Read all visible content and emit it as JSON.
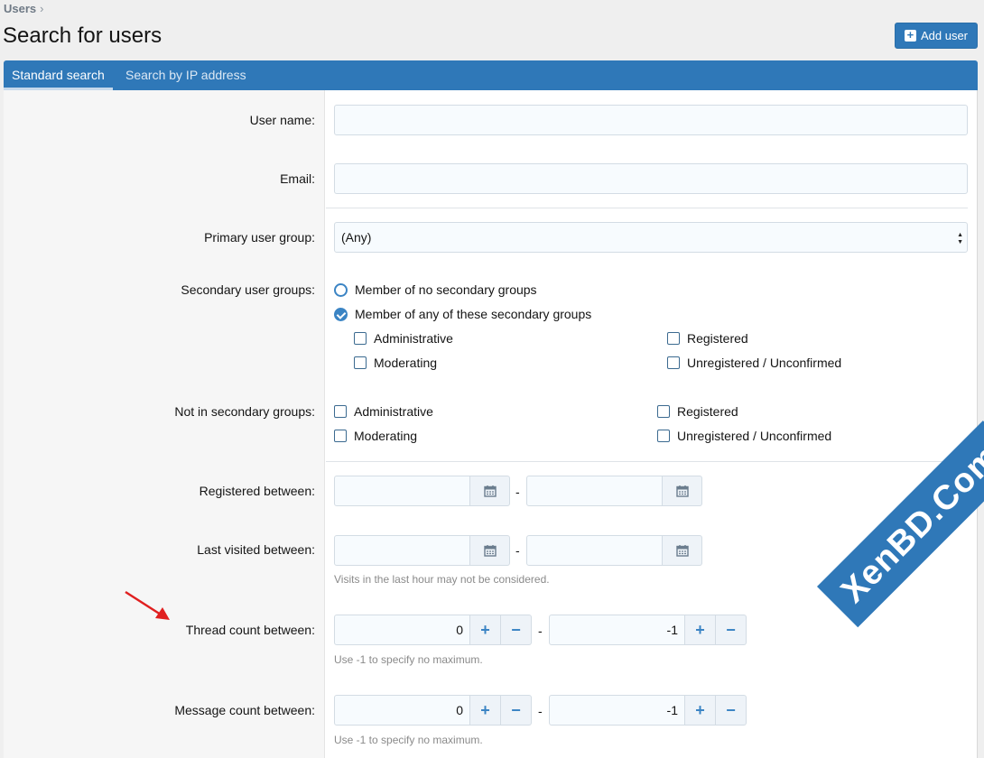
{
  "breadcrumb": {
    "item": "Users",
    "separator": "›"
  },
  "page_title": "Search for users",
  "add_user_label": "Add user",
  "tabs": [
    {
      "label": "Standard search",
      "active": true
    },
    {
      "label": "Search by IP address",
      "active": false
    }
  ],
  "form": {
    "user_name_label": "User name:",
    "user_name_value": "",
    "email_label": "Email:",
    "email_value": "",
    "primary_group_label": "Primary user group:",
    "primary_group_value": "(Any)",
    "secondary_groups_label": "Secondary user groups:",
    "secondary_options": [
      {
        "label": "Member of no secondary groups",
        "checked": false
      },
      {
        "label": "Member of any of these secondary groups",
        "checked": true
      }
    ],
    "secondary_groups": [
      "Administrative",
      "Registered",
      "Moderating",
      "Unregistered / Unconfirmed"
    ],
    "not_in_groups_label": "Not in secondary groups:",
    "not_in_groups": [
      "Administrative",
      "Registered",
      "Moderating",
      "Unregistered / Unconfirmed"
    ],
    "registered_between_label": "Registered between:",
    "last_visited_label": "Last visited between:",
    "last_visited_hint": "Visits in the last hour may not be considered.",
    "thread_count_label": "Thread count between:",
    "thread_count_min": "0",
    "thread_count_max": "-1",
    "thread_count_hint": "Use -1 to specify no maximum.",
    "message_count_label": "Message count between:",
    "message_count_min": "0",
    "message_count_max": "-1",
    "message_count_hint": "Use -1 to specify no maximum.",
    "range_separator": "-"
  },
  "watermark_text": "XenBD.Com",
  "colors": {
    "accent": "#2f78b8",
    "annotation_arrow": "#e02020"
  }
}
